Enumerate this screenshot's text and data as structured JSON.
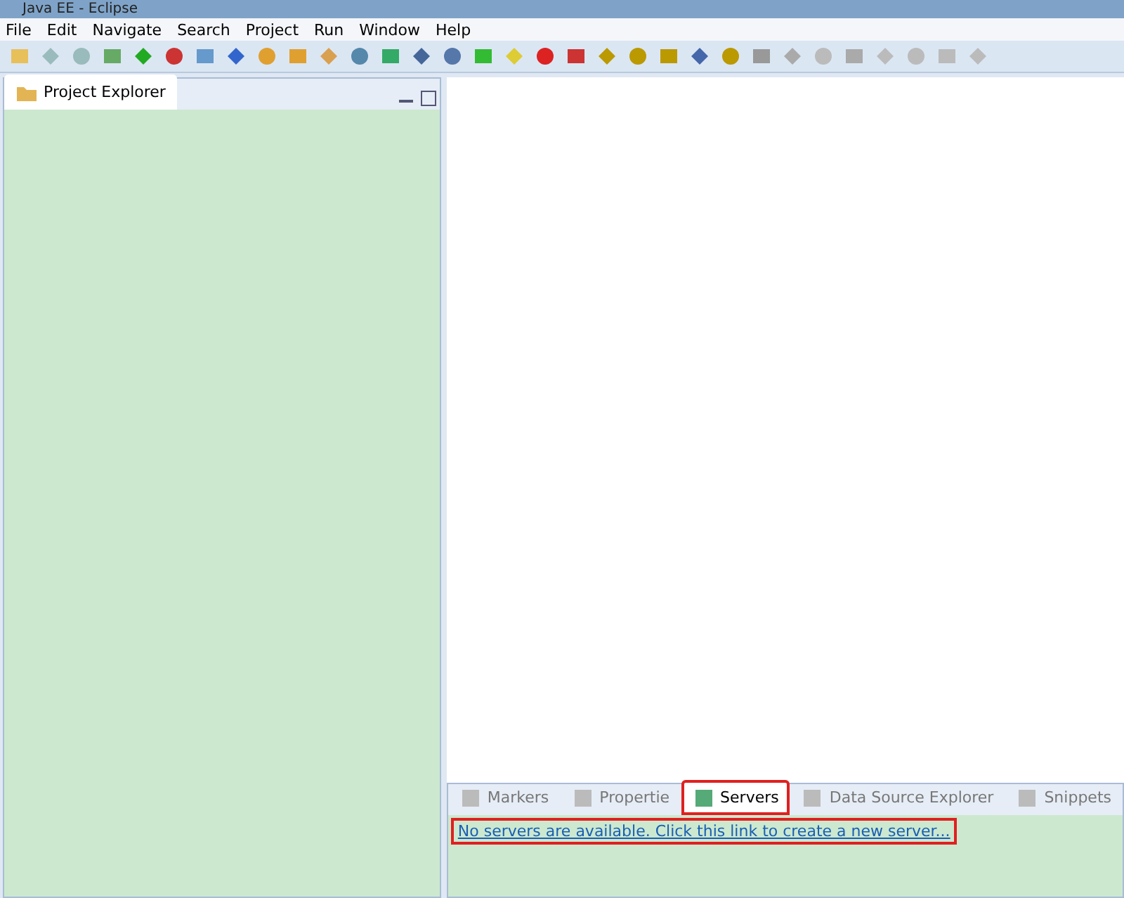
{
  "window": {
    "title": "Java EE - Eclipse"
  },
  "menu": [
    {
      "label": "File"
    },
    {
      "label": "Edit"
    },
    {
      "label": "Navigate"
    },
    {
      "label": "Search"
    },
    {
      "label": "Project"
    },
    {
      "label": "Run"
    },
    {
      "label": "Window"
    },
    {
      "label": "Help"
    }
  ],
  "left_view": {
    "tab": {
      "label": "Project Explorer",
      "selected": true
    }
  },
  "bottom_view": {
    "tabs": [
      {
        "label": "Markers",
        "selected": false,
        "highlighted": false
      },
      {
        "label": "Propertie",
        "selected": false,
        "highlighted": false
      },
      {
        "label": "Servers",
        "selected": true,
        "highlighted": true
      },
      {
        "label": "Data Source Explorer",
        "selected": false,
        "highlighted": false
      },
      {
        "label": "Snippets",
        "selected": false,
        "highlighted": false
      }
    ],
    "link": {
      "text": "No servers are available. Click this link to create a new server...",
      "highlighted": true
    }
  }
}
